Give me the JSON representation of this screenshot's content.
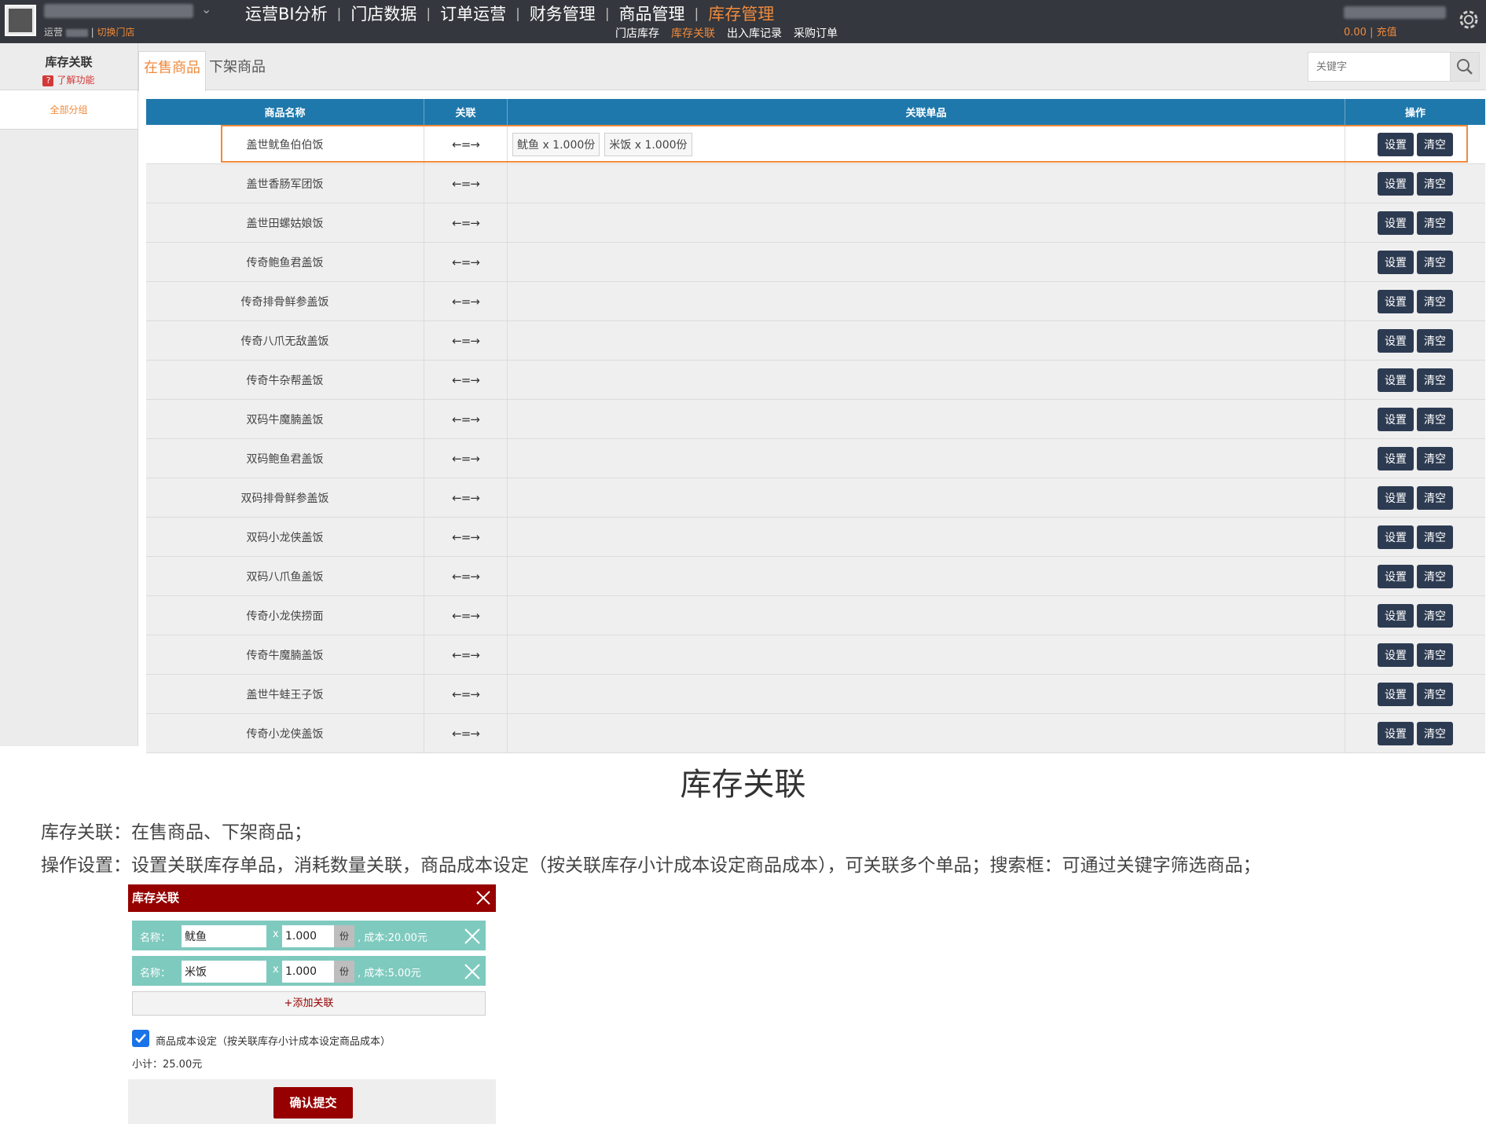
{
  "topbar": {
    "store_sub_label": "运营",
    "switch_store": "切换门店",
    "main_nav": [
      "运营BI分析",
      "门店数据",
      "订单运营",
      "财务管理",
      "商品管理",
      "库存管理"
    ],
    "main_nav_active": 5,
    "sub_nav": [
      "门店库存",
      "库存关联",
      "出入库记录",
      "采购订单"
    ],
    "sub_nav_active": 1,
    "balance": "0.00 | 充值"
  },
  "sidebar": {
    "title": "库存关联",
    "help": "了解功能",
    "help_icon": "?",
    "items": [
      "全部分组"
    ]
  },
  "tabs": [
    "在售商品",
    "下架商品"
  ],
  "search": {
    "placeholder": "关键字"
  },
  "table": {
    "headers": [
      "商品名称",
      "关联",
      "关联单品",
      "操作"
    ],
    "link_glyph": "←=→",
    "actions": [
      "设置",
      "清空"
    ],
    "rows": [
      {
        "name": "盖世鱿鱼伯伯饭",
        "items": [
          "鱿鱼 x 1.000份",
          "米饭 x 1.000份"
        ]
      },
      {
        "name": "盖世香肠军团饭",
        "items": []
      },
      {
        "name": "盖世田螺姑娘饭",
        "items": []
      },
      {
        "name": "传奇鲍鱼君盖饭",
        "items": []
      },
      {
        "name": "传奇排骨鲜参盖饭",
        "items": []
      },
      {
        "name": "传奇八爪无敌盖饭",
        "items": []
      },
      {
        "name": "传奇牛杂帮盖饭",
        "items": []
      },
      {
        "name": "双码牛魔腩盖饭",
        "items": []
      },
      {
        "name": "双码鲍鱼君盖饭",
        "items": []
      },
      {
        "name": "双码排骨鲜参盖饭",
        "items": []
      },
      {
        "name": "双码小龙侠盖饭",
        "items": []
      },
      {
        "name": "双码八爪鱼盖饭",
        "items": []
      },
      {
        "name": "传奇小龙侠捞面",
        "items": []
      },
      {
        "name": "传奇牛魔腩盖饭",
        "items": []
      },
      {
        "name": "盖世牛蛙王子饭",
        "items": []
      },
      {
        "name": "传奇小龙侠盖饭",
        "items": []
      }
    ]
  },
  "caption": {
    "title": "库存关联",
    "line1": "库存关联：在售商品、下架商品；",
    "line2": "操作设置：设置关联库存单品，消耗数量关联，商品成本设定（按关联库存小计成本设定商品成本），可关联多个单品；搜索框：可通过关键字筛选商品；"
  },
  "dialog": {
    "title": "库存关联",
    "name_label": "名称：",
    "times": "x",
    "rows": [
      {
        "name": "鱿鱼",
        "qty": "1.000",
        "unit": "份",
        "cost": ", 成本:20.00元"
      },
      {
        "name": "米饭",
        "qty": "1.000",
        "unit": "份",
        "cost": ", 成本:5.00元"
      }
    ],
    "add_label": "+添加关联",
    "cost_setting": "商品成本设定（按关联库存小计成本设定商品成本）",
    "subtotal": "小计：25.00元",
    "submit": "确认提交"
  },
  "colors": {
    "topbar_bg": "#34373d",
    "accent_orange": "#f08a3c",
    "table_header": "#1f78ab",
    "action_button": "#2d3b52",
    "dialog_header": "#960000",
    "dialog_row": "#7fcabe"
  },
  "icons": {
    "logo": "app-logo-icon",
    "store_dropdown": "chevron-down-icon",
    "settings": "gear-icon",
    "search": "search-icon",
    "close": "close-icon",
    "remove": "remove-row-icon",
    "checkbox": "checkbox-checked-icon"
  }
}
